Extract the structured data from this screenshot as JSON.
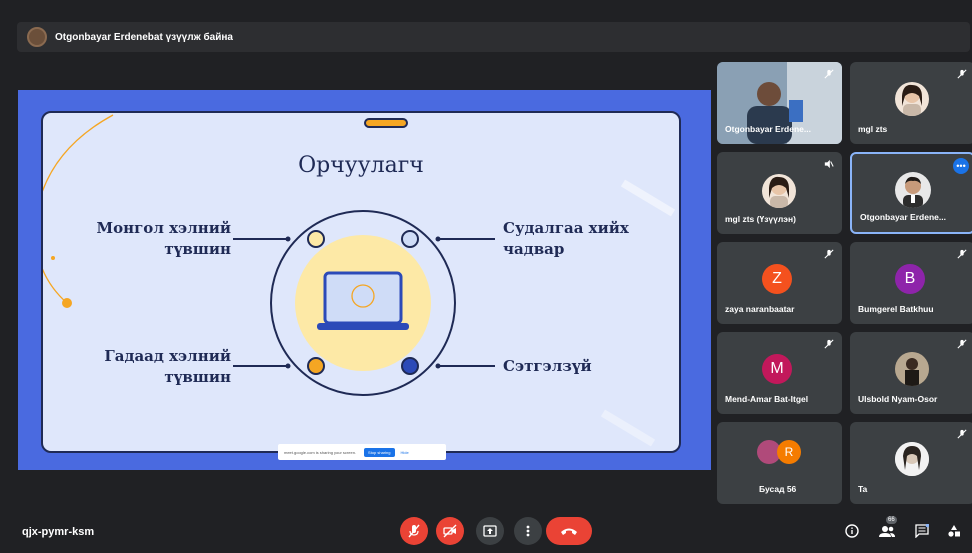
{
  "presenter_bar": {
    "text": "Otgonbayar Erdenebat үзүүлж байна"
  },
  "slide": {
    "title": "Орчуулагч",
    "labels": {
      "top_left": [
        "Монгол хэлний",
        "түвшин"
      ],
      "top_right": [
        "Судалгаа хийх",
        "чадвар"
      ],
      "bottom_left": [
        "Гадаад хэлний",
        "түвшин"
      ],
      "bottom_right": [
        "Сэтгэлзүй"
      ]
    },
    "colors": {
      "frame": "#4a6ae0",
      "bg": "#dfe7fb",
      "ink": "#1f2a55",
      "orange": "#f5a623",
      "yellow": "#fde9a6"
    }
  },
  "share_bar": {
    "text": "meet.google.com is sharing your screen.",
    "stop": "Stop sharing",
    "hide": "Hide"
  },
  "participants": [
    {
      "name": "Otgonbayar Erdene...",
      "kind": "video",
      "muted": true
    },
    {
      "name": "mgl zts",
      "kind": "photo",
      "muted": true
    },
    {
      "name": "mgl zts (Үзүүлэн)",
      "kind": "photo",
      "muted": false
    },
    {
      "name": "Otgonbayar Erdene...",
      "kind": "photo",
      "muted": false,
      "active": true
    },
    {
      "name": "zaya naranbaatar",
      "initial": "Z",
      "color": "#f4511e",
      "muted": true
    },
    {
      "name": "Bumgerel Batkhuu",
      "initial": "B",
      "color": "#8e24aa",
      "muted": true
    },
    {
      "name": "Mend-Amar Bat-Itgel",
      "initial": "M",
      "color": "#c2185b",
      "muted": true
    },
    {
      "name": "Ulsbold Nyam-Osor",
      "kind": "photo",
      "muted": true
    },
    {
      "name": "Бусад 56",
      "initial": "R",
      "color": "#f57c00",
      "muted": false
    },
    {
      "name": "Ta",
      "kind": "photo",
      "muted": true
    }
  ],
  "bottom": {
    "meeting_code": "qjx-pymr-ksm",
    "people_count": "66"
  },
  "icons": {
    "mic_off": "mic-off-icon",
    "cam_off": "camera-off-icon",
    "present": "present-icon",
    "more": "more-vert-icon",
    "end": "end-call-icon",
    "info": "info-icon",
    "people": "people-icon",
    "chat": "chat-icon",
    "activities": "activities-icon"
  }
}
